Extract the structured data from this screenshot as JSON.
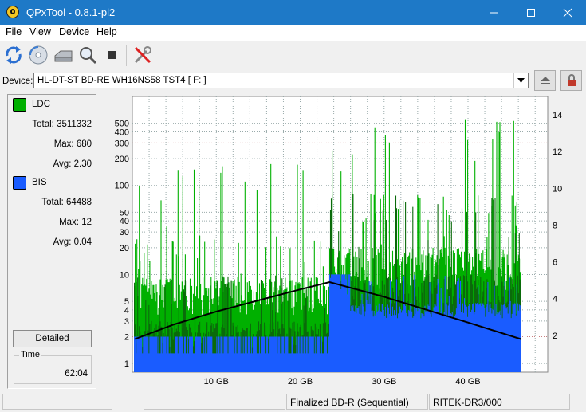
{
  "window": {
    "title": "QPxTool - 0.8.1-pl2"
  },
  "menu": [
    "File",
    "View",
    "Device",
    "Help"
  ],
  "device": {
    "label": "Device:",
    "value": "HL-DT-ST BD-RE  WH16NS58  TST4 [ F: ]"
  },
  "legend": {
    "ldc": {
      "name": "LDC",
      "color": "#00b000",
      "total_label": "Total:",
      "total": "3511332",
      "max_label": "Max:",
      "max": "680",
      "avg_label": "Avg:",
      "avg": "2.30"
    },
    "bis": {
      "name": "BIS",
      "color": "#1a5cff",
      "total_label": "Total:",
      "total": "64488",
      "max_label": "Max:",
      "max": "12",
      "avg_label": "Avg:",
      "avg": "0.04"
    }
  },
  "buttons": {
    "detailed": "Detailed"
  },
  "time": {
    "label": "Time",
    "value": "62:04"
  },
  "status": [
    "",
    "",
    "Finalized BD-R (Sequential)",
    "RITEK-DR3/000"
  ],
  "icons": [
    "refresh-icon",
    "disc-icon",
    "drive-icon",
    "magnifier-icon",
    "stop-icon",
    "tools-icon",
    "eject-icon",
    "lock-icon"
  ],
  "chart_data": {
    "type": "bar",
    "x_ticks": [
      "10 GB",
      "20 GB",
      "30 GB",
      "40 GB"
    ],
    "x_tick_values": [
      10,
      20,
      30,
      40
    ],
    "xlim": [
      0,
      49.5
    ],
    "y_left_ticks": [
      1,
      2,
      3,
      4,
      5,
      10,
      20,
      30,
      40,
      50,
      100,
      200,
      300,
      400,
      500
    ],
    "y_left_scale": "log",
    "ylim_left": [
      0.8,
      1000
    ],
    "y_right_ticks": [
      2,
      4,
      6,
      8,
      10,
      12,
      14
    ],
    "ylim_right": [
      0,
      15
    ],
    "grid": true,
    "series": [
      {
        "name": "LDC",
        "color": "#00b000",
        "axis": "left",
        "description": "dense bars, typical 3-10, peaks up to about 680"
      },
      {
        "name": "BIS",
        "color": "#1a5cff",
        "axis": "left",
        "description": "baseline 1-2, rising to about 4-10 between 23 and 46 GB"
      },
      {
        "color": "#000000",
        "axis": "right",
        "type": "line",
        "x": [
          0.3,
          5,
          10,
          15,
          20,
          23.5,
          30,
          35,
          40,
          46.3
        ],
        "y": [
          1.8,
          2.6,
          3.3,
          3.9,
          4.5,
          4.9,
          4.1,
          3.4,
          2.7,
          1.8
        ]
      }
    ]
  }
}
